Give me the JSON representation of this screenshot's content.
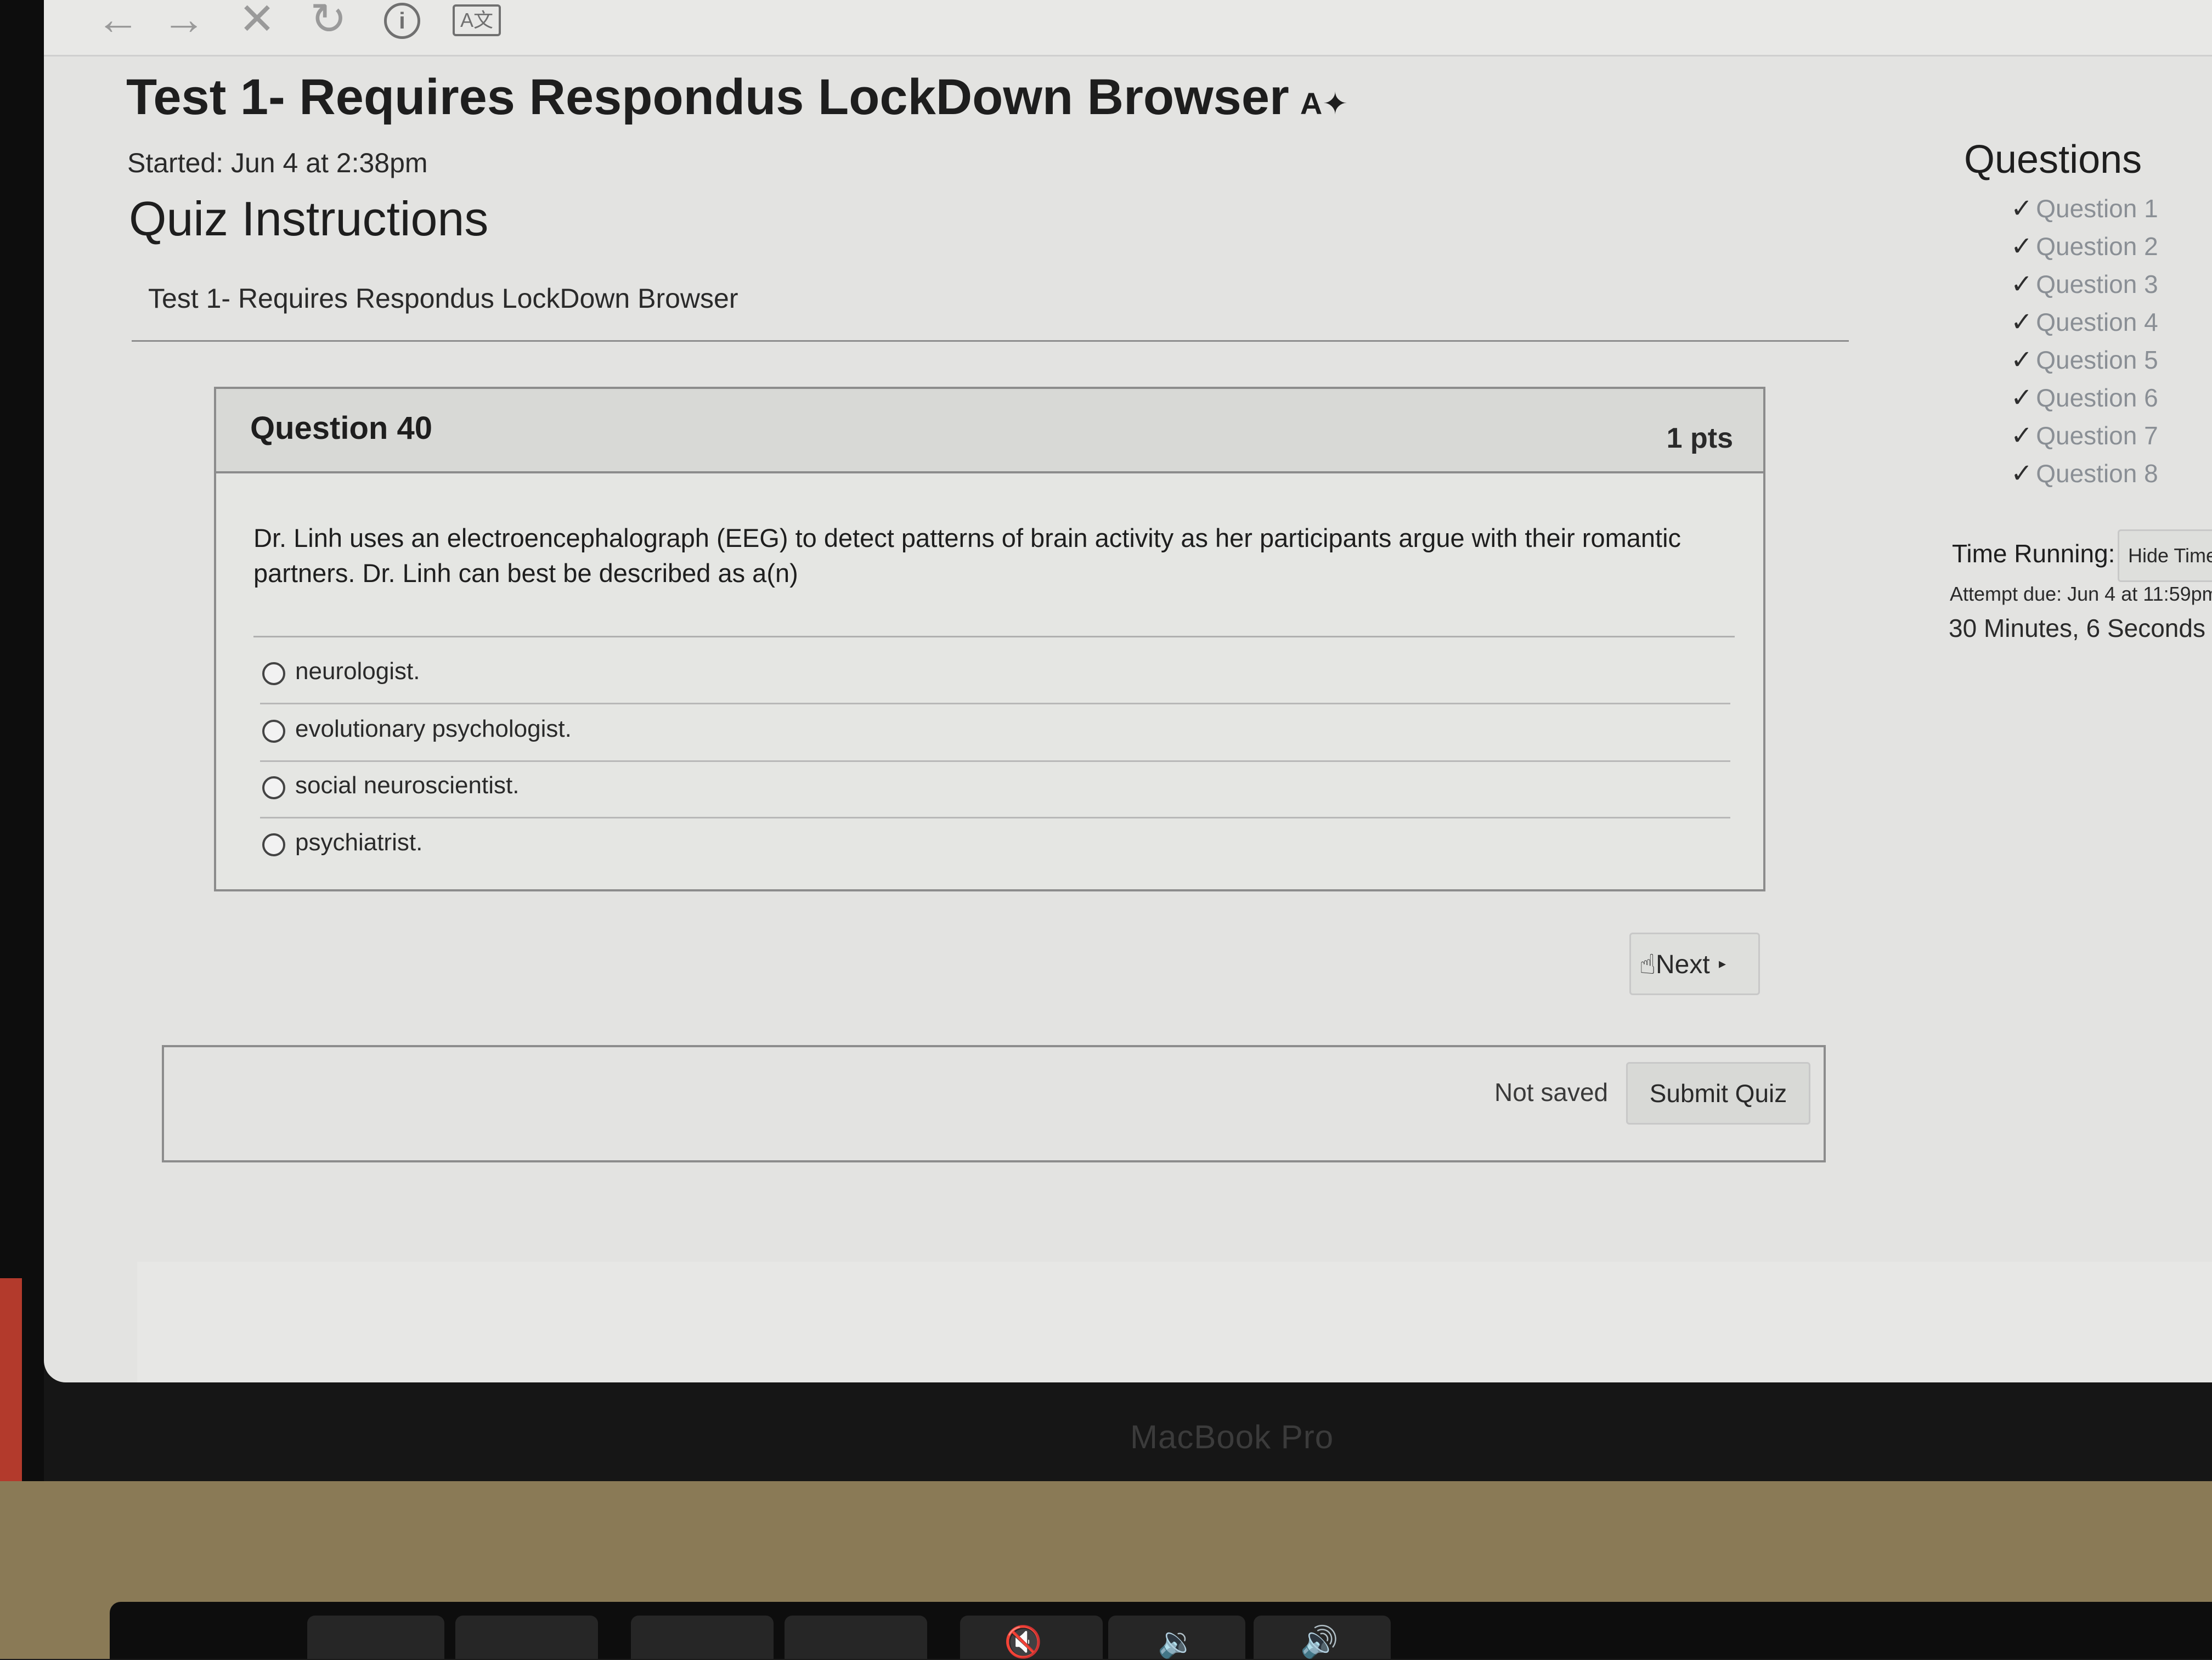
{
  "toolbar": {
    "back_icon": "arrow-left-icon",
    "forward_icon": "arrow-right-icon",
    "stop_icon": "close-icon",
    "reload_icon": "reload-icon",
    "info_label": "i",
    "translate_label": "A文"
  },
  "page": {
    "title": "Test 1- Requires Respondus LockDown Browser",
    "title_icon": "A",
    "started": "Started: Jun 4 at 2:38pm",
    "instructions_heading": "Quiz Instructions",
    "instructions_text": "Test 1- Requires Respondus LockDown Browser"
  },
  "question": {
    "title": "Question 40",
    "points": "1 pts",
    "text": "Dr. Linh uses an electroencephalograph (EEG) to detect patterns of brain activity as her participants argue with their romantic partners. Dr. Linh can best be described as a(n)",
    "answers": [
      {
        "label": "neurologist."
      },
      {
        "label": "evolutionary psychologist."
      },
      {
        "label": "social neuroscientist."
      },
      {
        "label": "psychiatrist."
      }
    ]
  },
  "navigation": {
    "next_label": "Next",
    "next_arrow": "▸"
  },
  "footer": {
    "status": "Not saved",
    "submit_label": "Submit Quiz"
  },
  "sidebar": {
    "title": "Questions",
    "items": [
      {
        "label": "Question 1",
        "answered": true
      },
      {
        "label": "Question 2",
        "answered": true
      },
      {
        "label": "Question 3",
        "answered": true
      },
      {
        "label": "Question 4",
        "answered": true
      },
      {
        "label": "Question 5",
        "answered": true
      },
      {
        "label": "Question 6",
        "answered": true
      },
      {
        "label": "Question 7",
        "answered": true
      },
      {
        "label": "Question 8",
        "answered": true
      }
    ],
    "time_running_label": "Time Running:",
    "hide_time_label": "Hide Time",
    "attempt_due": "Attempt due: Jun 4 at 11:59pm",
    "time_value": "30 Minutes, 6 Seconds"
  },
  "device": {
    "brand": "MacBook Pro"
  }
}
